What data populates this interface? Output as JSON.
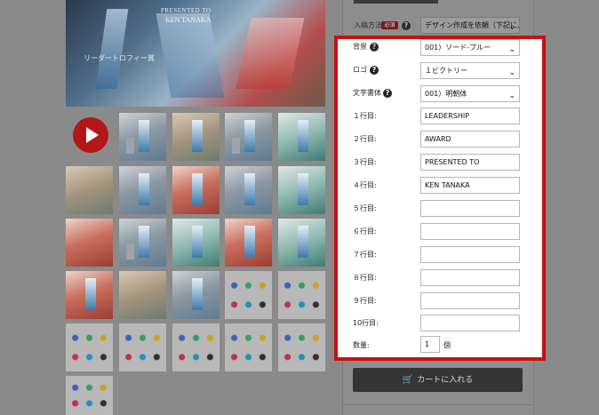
{
  "hero": {
    "caption_top": "PRESENTED TO",
    "caption_name": "KEN TANAKA",
    "side_text": "リーダートロフィー賞"
  },
  "options": {
    "inscription_method": {
      "label": "入稿方法",
      "required_badge": "必須",
      "value": "デザイン作成を依頼（下記に入力）"
    },
    "background": {
      "label": "背景",
      "value": "001）ソード-ブルー"
    },
    "logo": {
      "label": "ロゴ",
      "value": "１ビクトリー"
    },
    "font": {
      "label": "文字書体",
      "value": "001）明朝体"
    },
    "lines": [
      {
        "label": "１行目:",
        "value": "LEADERSHIP"
      },
      {
        "label": "２行目:",
        "value": "AWARD"
      },
      {
        "label": "３行目:",
        "value": "PRESENTED TO"
      },
      {
        "label": "４行目:",
        "value": "KEN TANAKA"
      },
      {
        "label": "５行目:",
        "value": ""
      },
      {
        "label": "６行目:",
        "value": ""
      },
      {
        "label": "７行目:",
        "value": ""
      },
      {
        "label": "８行目:",
        "value": ""
      },
      {
        "label": "９行目:",
        "value": ""
      },
      {
        "label": "10行目:",
        "value": ""
      }
    ],
    "quantity": {
      "label": "数量:",
      "value": "1",
      "unit": "個"
    }
  },
  "cart_button": {
    "label": "カートに入れる"
  },
  "colors": {
    "highlight": "#c81010",
    "cart_bg": "#353535",
    "video_red": "#b31616"
  }
}
